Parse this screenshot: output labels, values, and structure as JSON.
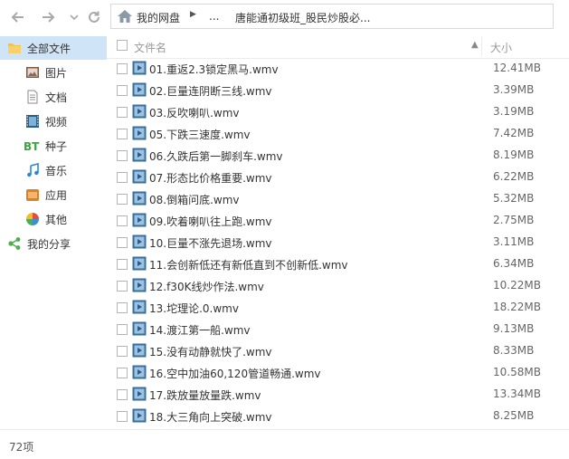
{
  "address_bar": {
    "breadcrumbs": [
      "我的网盘",
      "...",
      "唐能通初级班_股民炒股必..."
    ]
  },
  "sidebar": {
    "items": [
      {
        "label": "全部文件",
        "icon": "all-files-icon",
        "active": true
      },
      {
        "label": "图片",
        "icon": "image-icon",
        "active": false
      },
      {
        "label": "文档",
        "icon": "document-icon",
        "active": false
      },
      {
        "label": "视频",
        "icon": "video-icon",
        "active": false
      },
      {
        "label": "种子",
        "icon": "bt-icon",
        "active": false
      },
      {
        "label": "音乐",
        "icon": "music-icon",
        "active": false
      },
      {
        "label": "应用",
        "icon": "app-icon",
        "active": false
      },
      {
        "label": "其他",
        "icon": "other-icon",
        "active": false
      },
      {
        "label": "我的分享",
        "icon": "share-icon",
        "active": false
      }
    ]
  },
  "file_list": {
    "columns": {
      "name": "文件名",
      "size": "大小",
      "sort_indicator": "▲"
    },
    "rows": [
      {
        "name": "01.重返2.3锁定黑马.wmv",
        "size": "12.41MB"
      },
      {
        "name": "02.巨量连阴断三线.wmv",
        "size": "3.39MB"
      },
      {
        "name": "03.反吹喇叭.wmv",
        "size": "3.19MB"
      },
      {
        "name": "05.下跌三速度.wmv",
        "size": "7.42MB"
      },
      {
        "name": "06.久跌后第一脚刹车.wmv",
        "size": "8.19MB"
      },
      {
        "name": "07.形态比价格重要.wmv",
        "size": "6.22MB"
      },
      {
        "name": "08.倒箱问底.wmv",
        "size": "5.32MB"
      },
      {
        "name": "09.吹着喇叭往上跑.wmv",
        "size": "2.75MB"
      },
      {
        "name": "10.巨量不涨先退场.wmv",
        "size": "3.11MB"
      },
      {
        "name": "11.会创新低还有新低直到不创新低.wmv",
        "size": "6.34MB"
      },
      {
        "name": "12.f30K线炒作法.wmv",
        "size": "10.22MB"
      },
      {
        "name": "13.坨理论.0.wmv",
        "size": "18.22MB"
      },
      {
        "name": "14.渡江第一船.wmv",
        "size": "9.13MB"
      },
      {
        "name": "15.没有动静就快了.wmv",
        "size": "8.33MB"
      },
      {
        "name": "16.空中加油60,120管道畅通.wmv",
        "size": "10.58MB"
      },
      {
        "name": "17.跌放量放量跌.wmv",
        "size": "13.34MB"
      },
      {
        "name": "18.大三角向上突破.wmv",
        "size": "8.25MB"
      }
    ]
  },
  "status_bar": {
    "count": "72项"
  }
}
